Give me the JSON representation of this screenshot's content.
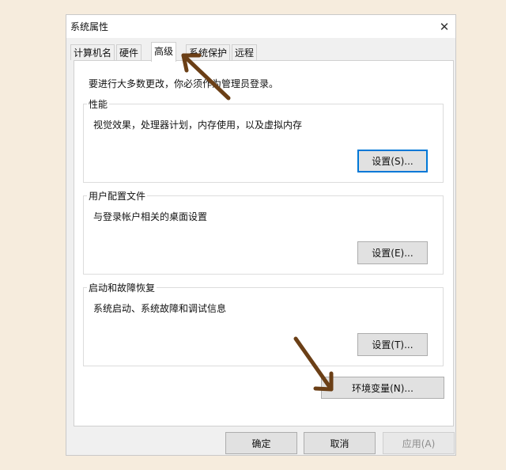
{
  "window": {
    "title": "系统属性",
    "close_glyph": "✕"
  },
  "tabs": [
    {
      "label": "计算机名",
      "active": false
    },
    {
      "label": "硬件",
      "active": false
    },
    {
      "label": "高级",
      "active": true
    },
    {
      "label": "系统保护",
      "active": false
    },
    {
      "label": "远程",
      "active": false
    }
  ],
  "advanced": {
    "admin_note": "要进行大多数更改，你必须作为管理员登录。",
    "performance": {
      "legend": "性能",
      "description": "视觉效果，处理器计划，内存使用，以及虚拟内存",
      "settings_button": "设置(S)..."
    },
    "user_profiles": {
      "legend": "用户配置文件",
      "description": "与登录帐户相关的桌面设置",
      "settings_button": "设置(E)..."
    },
    "startup_recovery": {
      "legend": "启动和故障恢复",
      "description": "系统启动、系统故障和调试信息",
      "settings_button": "设置(T)..."
    },
    "env_vars_button": "环境变量(N)..."
  },
  "footer": {
    "ok_button": "确定",
    "cancel_button": "取消",
    "apply_button": "应用(A)"
  },
  "colors": {
    "background": "#f6ecdd",
    "annotation_arrow": "#6b3f16",
    "focus_border": "#0078d7"
  }
}
